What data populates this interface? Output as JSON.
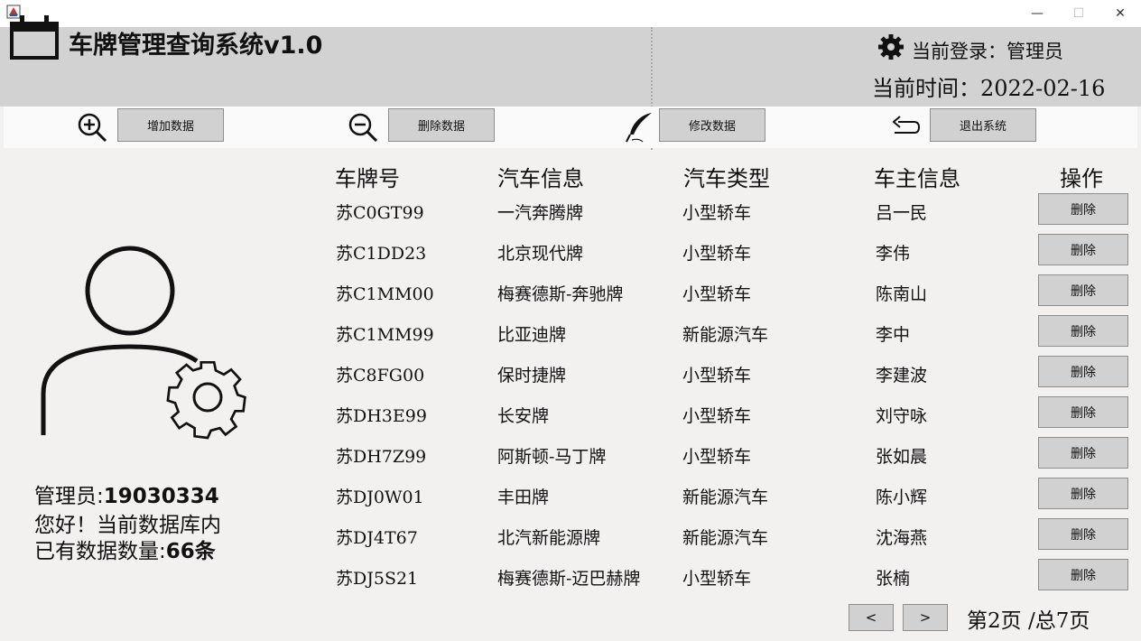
{
  "window": {
    "title": "",
    "min_glyph": "—",
    "max_glyph": "☐",
    "close_glyph": "✕"
  },
  "header": {
    "title": "车牌管理查询系统v1.0",
    "login_label": "当前登录：管理员",
    "time_label": "当前时间：",
    "date": "2022-02-16"
  },
  "toolbar": {
    "add_label": "增加数据",
    "delete_label": "删除数据",
    "modify_label": "修改数据",
    "exit_label": "退出系统"
  },
  "sidebar": {
    "admin_prefix": "管理员:",
    "admin_id": "19030334",
    "greeting": "您好！当前数据库内",
    "count_prefix": "已有数据数量:",
    "count_value": "66条"
  },
  "table": {
    "headers": [
      "车牌号",
      "汽车信息",
      "汽车类型",
      "车主信息",
      "操作"
    ],
    "delete_label": "删除",
    "rows": [
      {
        "plate": "苏C0GT99",
        "car": "一汽奔腾牌",
        "type": "小型轿车",
        "owner": "吕一民"
      },
      {
        "plate": "苏C1DD23",
        "car": "北京现代牌",
        "type": "小型轿车",
        "owner": "李伟"
      },
      {
        "plate": "苏C1MM00",
        "car": "梅赛德斯-奔驰牌",
        "type": "小型轿车",
        "owner": "陈南山"
      },
      {
        "plate": "苏C1MM99",
        "car": "比亚迪牌",
        "type": "新能源汽车",
        "owner": "李中"
      },
      {
        "plate": "苏C8FG00",
        "car": "保时捷牌",
        "type": "小型轿车",
        "owner": "李建波"
      },
      {
        "plate": "苏DH3E99",
        "car": "长安牌",
        "type": "小型轿车",
        "owner": "刘守咏"
      },
      {
        "plate": "苏DH7Z99",
        "car": "阿斯顿-马丁牌",
        "type": "小型轿车",
        "owner": "张如晨"
      },
      {
        "plate": "苏DJ0W01",
        "car": "丰田牌",
        "type": "新能源汽车",
        "owner": "陈小辉"
      },
      {
        "plate": "苏DJ4T67",
        "car": "北汽新能源牌",
        "type": "新能源汽车",
        "owner": "沈海燕"
      },
      {
        "plate": "苏DJ5S21",
        "car": "梅赛德斯-迈巴赫牌",
        "type": "小型轿车",
        "owner": "张楠"
      }
    ]
  },
  "pagination": {
    "prev_label": "<",
    "next_label": ">",
    "page_text": "第2页  /总7页"
  },
  "icons": {
    "app": "app-logo-icon",
    "calendar": "calendar-icon",
    "gear": "gear-icon",
    "zoom_in": "zoom-in-icon",
    "zoom_out": "zoom-out-icon",
    "feather": "feather-pen-icon",
    "back": "back-arrow-icon",
    "user_settings": "user-settings-icon"
  }
}
